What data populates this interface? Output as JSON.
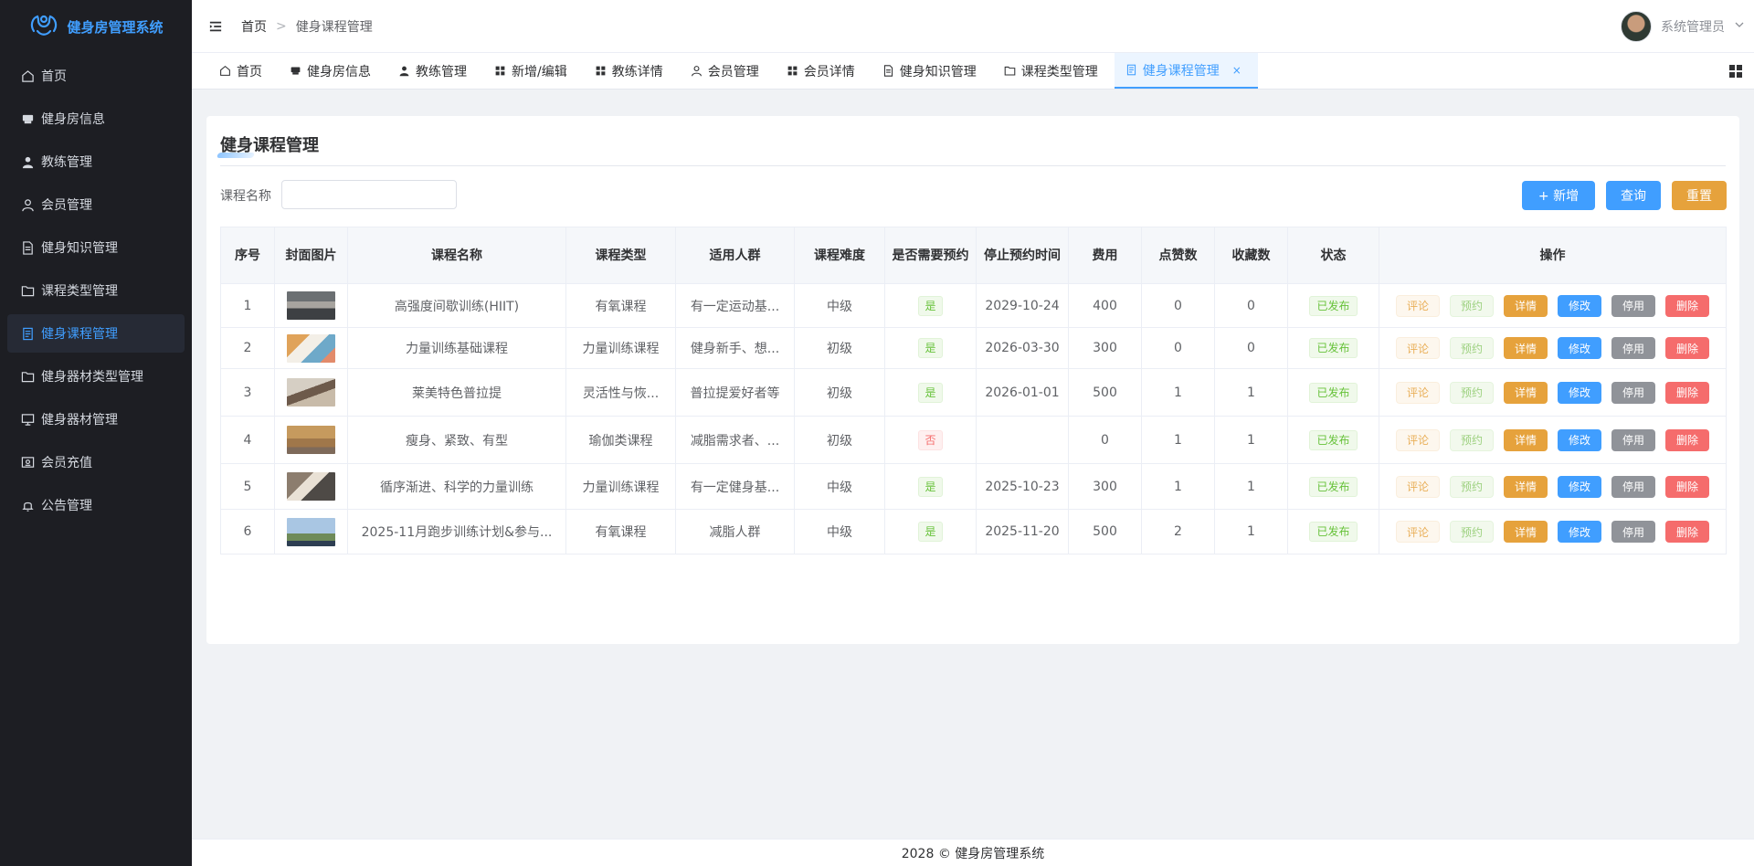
{
  "brand": {
    "name": "健身房管理系统"
  },
  "sidebar": {
    "items": [
      {
        "label": "首页",
        "icon": "home-icon"
      },
      {
        "label": "健身房信息",
        "icon": "store-icon"
      },
      {
        "label": "教练管理",
        "icon": "user-filled-icon"
      },
      {
        "label": "会员管理",
        "icon": "user-icon"
      },
      {
        "label": "健身知识管理",
        "icon": "document-icon"
      },
      {
        "label": "课程类型管理",
        "icon": "folder-icon"
      },
      {
        "label": "健身课程管理",
        "icon": "document-list-icon",
        "active": true
      },
      {
        "label": "健身器材类型管理",
        "icon": "folder-icon"
      },
      {
        "label": "健身器材管理",
        "icon": "monitor-icon"
      },
      {
        "label": "会员充值",
        "icon": "wallet-icon"
      },
      {
        "label": "公告管理",
        "icon": "bell-icon"
      }
    ]
  },
  "header": {
    "breadcrumb": [
      "首页",
      "健身课程管理"
    ],
    "user_name": "系统管理员"
  },
  "tabs": [
    {
      "label": "首页",
      "icon": "home-icon"
    },
    {
      "label": "健身房信息",
      "icon": "store-icon"
    },
    {
      "label": "教练管理",
      "icon": "user-filled-icon"
    },
    {
      "label": "新增/编辑",
      "icon": "grid-icon"
    },
    {
      "label": "教练详情",
      "icon": "grid-icon"
    },
    {
      "label": "会员管理",
      "icon": "user-icon"
    },
    {
      "label": "会员详情",
      "icon": "grid-icon"
    },
    {
      "label": "健身知识管理",
      "icon": "document-icon"
    },
    {
      "label": "课程类型管理",
      "icon": "folder-icon"
    },
    {
      "label": "健身课程管理",
      "icon": "document-list-icon",
      "active": true,
      "close": "×"
    }
  ],
  "page": {
    "title": "健身课程管理",
    "search": {
      "label": "课程名称",
      "value": "",
      "placeholder": ""
    },
    "buttons": {
      "add": "+ 新增",
      "query": "查询",
      "reset": "重置"
    }
  },
  "table": {
    "columns": [
      "序号",
      "封面图片",
      "课程名称",
      "课程类型",
      "适用人群",
      "课程难度",
      "是否需要预约",
      "停止预约时间",
      "费用",
      "点赞数",
      "收藏数",
      "状态",
      "操作"
    ],
    "ops": [
      "评论",
      "预约",
      "详情",
      "修改",
      "停用",
      "删除"
    ],
    "rows": [
      {
        "no": "1",
        "thumb": "gym",
        "name": "高强度间歇训练(HIIT)",
        "type": "有氧课程",
        "crowd": "有一定运动基...",
        "level": "中级",
        "booking": "是",
        "deadline": "2029-10-24",
        "fee": "400",
        "likes": "0",
        "favs": "0",
        "status": "已发布"
      },
      {
        "no": "2",
        "thumb": "fitness",
        "name": "力量训练基础课程",
        "type": "力量训练课程",
        "crowd": "健身新手、想...",
        "level": "初级",
        "booking": "是",
        "deadline": "2026-03-30",
        "fee": "300",
        "likes": "0",
        "favs": "0",
        "status": "已发布"
      },
      {
        "no": "3",
        "thumb": "pilates",
        "name": "莱美特色普拉提",
        "type": "灵活性与恢...",
        "crowd": "普拉提爱好者等",
        "level": "初级",
        "booking": "是",
        "deadline": "2026-01-01",
        "fee": "500",
        "likes": "1",
        "favs": "1",
        "status": "已发布"
      },
      {
        "no": "4",
        "thumb": "yoga",
        "name": "瘦身、紧致、有型",
        "type": "瑜伽类课程",
        "crowd": "减脂需求者、...",
        "level": "初级",
        "booking": "否",
        "deadline": "",
        "fee": "0",
        "likes": "1",
        "favs": "1",
        "status": "已发布"
      },
      {
        "no": "5",
        "thumb": "strength",
        "name": "循序渐进、科学的力量训练",
        "type": "力量训练课程",
        "crowd": "有一定健身基...",
        "level": "中级",
        "booking": "是",
        "deadline": "2025-10-23",
        "fee": "300",
        "likes": "1",
        "favs": "1",
        "status": "已发布"
      },
      {
        "no": "6",
        "thumb": "running",
        "name": "2025-11月跑步训练计划&参与...",
        "type": "有氧课程",
        "crowd": "减脂人群",
        "level": "中级",
        "booking": "是",
        "deadline": "2025-11-20",
        "fee": "500",
        "likes": "2",
        "favs": "1",
        "status": "已发布"
      }
    ]
  },
  "footer": {
    "text": "2028 © 健身房管理系统"
  },
  "colors": {
    "primary": "#409eff",
    "warning": "#e6a23c",
    "danger": "#f56c6c",
    "info": "#909399",
    "success": "#67c23a",
    "sidebar_bg": "#1d1e23"
  }
}
